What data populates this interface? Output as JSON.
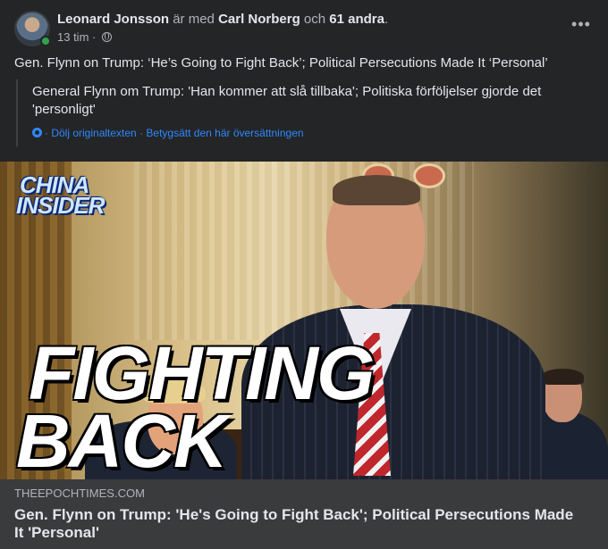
{
  "post": {
    "author": "Leonard Jonsson",
    "with_text": "är med",
    "tagged": "Carl Norberg",
    "and_text": "och",
    "others": "61 andra",
    "period": ".",
    "time": "13 tim",
    "separator": "·",
    "audience_icon": "globe-icon",
    "more_label": "•••",
    "text": "Gen. Flynn on Trump: ‘He’s Going to Fight Back’; Political Persecutions Made It ‘Personal’"
  },
  "translation": {
    "text": "General Flynn om Trump: 'Han kommer att slå tillbaka'; Politiska förföljelser gjorde det 'personligt'",
    "hide_original": "Dölj originaltexten",
    "rate": "Betygsätt den här översättningen",
    "dot": "·",
    "icon": "gear-icon"
  },
  "link_card": {
    "image": {
      "logo_line1": "CHINA",
      "logo_line2": "INSIDER",
      "headline_line1": "FIGHTING",
      "headline_line2": "BACK"
    },
    "domain": "THEEPOCHTIMES.COM",
    "title": "Gen. Flynn on Trump: 'He's Going to Fight Back'; Political Persecutions Made It 'Personal'"
  },
  "colors": {
    "background": "#242526",
    "link_blue": "#2d88ff",
    "online_green": "#31a24c",
    "card_footer": "#3a3b3c"
  }
}
